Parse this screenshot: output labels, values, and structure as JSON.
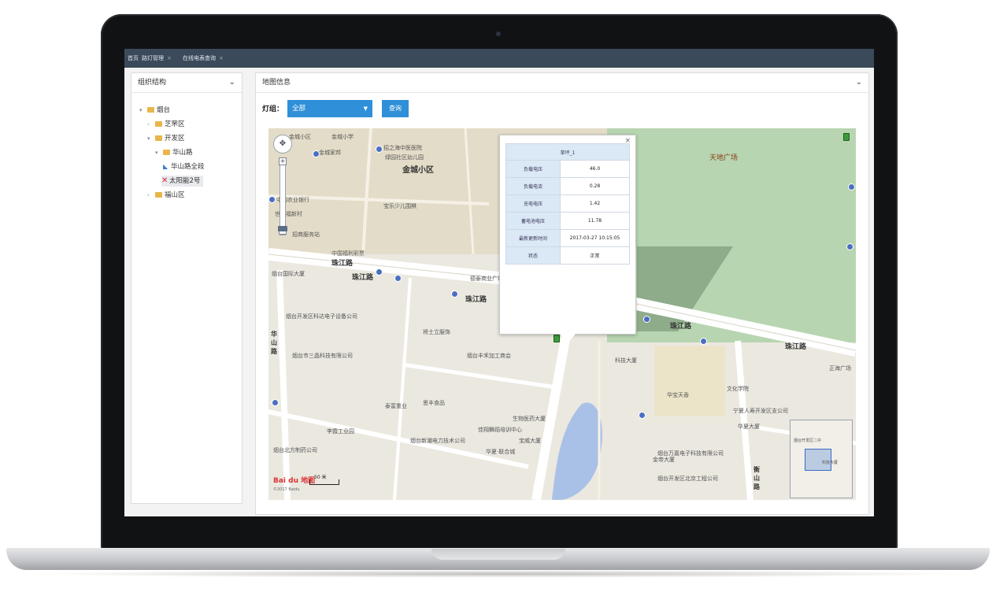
{
  "tabs": [
    {
      "label": "首页",
      "closable": false
    },
    {
      "label": "路灯管理",
      "closable": true
    },
    {
      "label": "在线电表查询",
      "closable": true
    }
  ],
  "left_panel": {
    "title": "组织结构",
    "tree": [
      {
        "label": "烟台",
        "level": 0,
        "expanded": true,
        "type": "folder"
      },
      {
        "label": "芝罘区",
        "level": 1,
        "expanded": false,
        "type": "folder"
      },
      {
        "label": "开发区",
        "level": 1,
        "expanded": true,
        "type": "folder"
      },
      {
        "label": "华山路",
        "level": 2,
        "expanded": true,
        "type": "folder"
      },
      {
        "label": "华山路全段",
        "level": 3,
        "type": "leaf"
      },
      {
        "label": "太阳能2号",
        "level": 3,
        "type": "error",
        "selected": true
      },
      {
        "label": "福山区",
        "level": 1,
        "expanded": false,
        "type": "folder"
      }
    ]
  },
  "right_panel": {
    "title": "地图信息",
    "filter": {
      "label": "灯组：",
      "selected": "全部",
      "query_button": "查询"
    }
  },
  "map": {
    "labels": {
      "park": "天地广场",
      "district": "金城小区",
      "road1": "珠江路",
      "road2": "珠江路",
      "road3": "珠江路",
      "road4": "珠江路",
      "road5": "珠江路",
      "road_hua": "华山路",
      "road_heng": "衡山路"
    },
    "pois": [
      "金城小区",
      "金城小学",
      "金城家邦",
      "招之海中医医院",
      "绿园社区幼儿园",
      "中国农业银行",
      "烟台国际大厦",
      "中国福利彩票",
      "德泰商业广场",
      "世纪福新村",
      "招商服务站",
      "宝乐少儿围棋",
      "烟台开发区科达电子设备公司",
      "将士立服饰",
      "烟台市三晶科技有限公司",
      "烟台丰禾加工商会",
      "泰富重业",
      "思丰食品",
      "李霞工业园",
      "佳翔舞蹈培训中心",
      "宝威大厦",
      "生物医药大厦",
      "烟台北方制药公司",
      "烟台新潮电力技术公司",
      "华夏·联合城",
      "宁夏人寿开发区支公司",
      "华夏大厦",
      "金帝大厦",
      "烟台万嘉电子科技有限公司",
      "烟台开发区北京工程公司",
      "科技大厦",
      "华宝天香",
      "文化学院",
      "正海广场"
    ],
    "logo": "Bai du 地图",
    "logo_sub": "©2017 Baidu",
    "scale": "50 米",
    "minimap_label": "烟台开发区二中",
    "minimap_label2": "科技大厦"
  },
  "popup": {
    "title": "草坪_1",
    "rows": [
      {
        "key": "负载电压",
        "value": "46.0"
      },
      {
        "key": "负载电流",
        "value": "0.28"
      },
      {
        "key": "充电电压",
        "value": "1.42"
      },
      {
        "key": "蓄电池电压",
        "value": "11.78"
      },
      {
        "key": "最新更新时间",
        "value": "2017-03-27 10:15:05"
      },
      {
        "key": "状态",
        "value": "正常"
      }
    ]
  }
}
